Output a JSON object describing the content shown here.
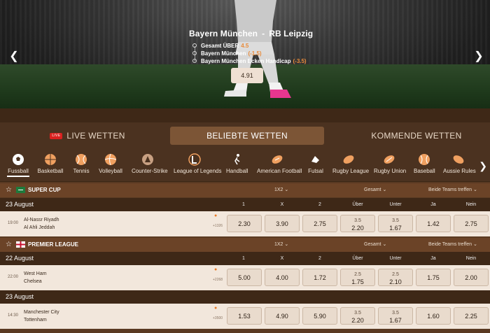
{
  "hero": {
    "home": "Bayern München",
    "sep": "-",
    "away": "RB Leipzig",
    "bets": [
      {
        "label": "Gesamt ÜBER",
        "odd": "4.5"
      },
      {
        "label": "Bayern München",
        "odd": "(-1.5)"
      },
      {
        "label": "Bayern München Ecken Handicap",
        "odd": "(-3.5)"
      }
    ],
    "combined_odd": "4.91",
    "prev_icon": "chevron-left-icon",
    "next_icon": "chevron-right-icon"
  },
  "tabs": {
    "live_badge": "LIVE",
    "live": "LIVE WETTEN",
    "beliebte": "BELIEBTE WETTEN",
    "kommende": "KOMMENDE WETTEN"
  },
  "sports": [
    {
      "label": "Fussball",
      "icon": "soccer-ball-icon",
      "active": true
    },
    {
      "label": "Basketball",
      "icon": "basketball-icon"
    },
    {
      "label": "Tennis",
      "icon": "tennis-ball-icon"
    },
    {
      "label": "Volleyball",
      "icon": "volleyball-icon"
    },
    {
      "label": "Counter-Strike",
      "icon": "counter-strike-icon"
    },
    {
      "label": "League of Legends",
      "icon": "league-of-legends-icon"
    },
    {
      "label": "Handball",
      "icon": "handball-icon"
    },
    {
      "label": "American Football",
      "icon": "american-football-icon"
    },
    {
      "label": "Futsal",
      "icon": "futsal-icon"
    },
    {
      "label": "Rugby League",
      "icon": "rugby-league-icon"
    },
    {
      "label": "Rugby Union",
      "icon": "rugby-union-icon"
    },
    {
      "label": "Baseball",
      "icon": "baseball-icon"
    },
    {
      "label": "Aussie Rules",
      "icon": "aussie-rules-icon"
    }
  ],
  "market_selects": {
    "main": "1X2",
    "total": "Gesamt",
    "btts": "Beide Teams treffen"
  },
  "columns": [
    "1",
    "X",
    "2",
    "Über",
    "Unter",
    "Ja",
    "Nein"
  ],
  "leagues": [
    {
      "name": "SUPER CUP",
      "flag_color": "#1f7a3c",
      "date": "23 August",
      "match": {
        "time": "19:00",
        "home": "Al-Nassr Riyadh",
        "away": "Al Ahli Jeddah",
        "more": "+1326",
        "odds": [
          "2.30",
          "3.90",
          "2.75"
        ],
        "over": {
          "line": "3.5",
          "odd": "2.20"
        },
        "under": {
          "line": "3.5",
          "odd": "1.67"
        },
        "ja": "1.42",
        "nein": "2.75"
      }
    },
    {
      "name": "PREMIER LEAGUE",
      "flag_color": "#c8102e",
      "date": "22 August",
      "match": {
        "time": "22:00",
        "home": "West Ham",
        "away": "Chelsea",
        "more": "+2268",
        "odds": [
          "5.00",
          "4.00",
          "1.72"
        ],
        "over": {
          "line": "2.5",
          "odd": "1.75"
        },
        "under": {
          "line": "2.5",
          "odd": "2.10"
        },
        "ja": "1.75",
        "nein": "2.00"
      }
    }
  ],
  "third_date": "23 August",
  "third_match": {
    "time": "14:30",
    "home": "Manchester City",
    "away": "Tottenham",
    "more": "+3500",
    "odds": [
      "1.53",
      "4.90",
      "5.90"
    ],
    "over": {
      "line": "3.5",
      "odd": "2.20"
    },
    "under": {
      "line": "3.5",
      "odd": "1.67"
    },
    "ja": "1.60",
    "nein": "2.25"
  }
}
